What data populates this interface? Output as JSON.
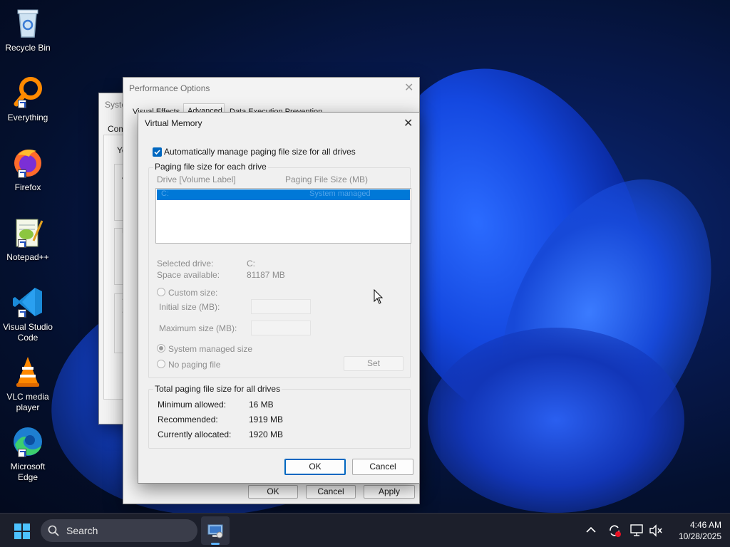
{
  "desktop_icons": [
    {
      "label": "Recycle Bin",
      "icon": "recycle-bin-icon"
    },
    {
      "label": "Everything",
      "icon": "everything-search-icon"
    },
    {
      "label": "Firefox",
      "icon": "firefox-icon"
    },
    {
      "label": "Notepad++",
      "icon": "notepad-plus-plus-icon"
    },
    {
      "label": "Visual Studio Code",
      "icon": "vscode-icon"
    },
    {
      "label": "VLC media player",
      "icon": "vlc-icon"
    },
    {
      "label": "Microsoft Edge",
      "icon": "edge-icon"
    }
  ],
  "system_props": {
    "title_partial": "Syste",
    "side_letters": [
      "Com",
      "Yo",
      "P",
      "V",
      "U",
      "D",
      "S",
      "S"
    ]
  },
  "perf_options": {
    "title": "Performance Options",
    "tabs": [
      "Visual Effects",
      "Advanced",
      "Data Execution Prevention"
    ],
    "ok": "OK",
    "cancel": "Cancel",
    "apply": "Apply"
  },
  "virtual_memory": {
    "title": "Virtual Memory",
    "auto_manage_label": "Automatically manage paging file size for all drives",
    "auto_manage_checked": true,
    "group_each_drive": "Paging file size for each drive",
    "col_drive": "Drive  [Volume Label]",
    "col_size": "Paging File Size (MB)",
    "drives": [
      {
        "drive": "C:",
        "size": "System managed"
      }
    ],
    "selected_drive_label": "Selected drive:",
    "selected_drive_value": "C:",
    "space_available_label": "Space available:",
    "space_available_value": "81187 MB",
    "custom_size": "Custom size:",
    "initial_size": "Initial size (MB):",
    "maximum_size": "Maximum size (MB):",
    "system_managed": "System managed size",
    "no_paging": "No paging file",
    "set": "Set",
    "group_total": "Total paging file size for all drives",
    "min_allowed_label": "Minimum allowed:",
    "min_allowed_value": "16 MB",
    "recommended_label": "Recommended:",
    "recommended_value": "1919 MB",
    "allocated_label": "Currently allocated:",
    "allocated_value": "1920 MB",
    "ok": "OK",
    "cancel": "Cancel"
  },
  "taskbar": {
    "search_placeholder": "Search",
    "time": "4:46 AM",
    "date": "10/28/2025"
  },
  "colors": {
    "accent": "#0067c0",
    "selection": "#0078d7",
    "taskbar": "#1c1f2b"
  }
}
